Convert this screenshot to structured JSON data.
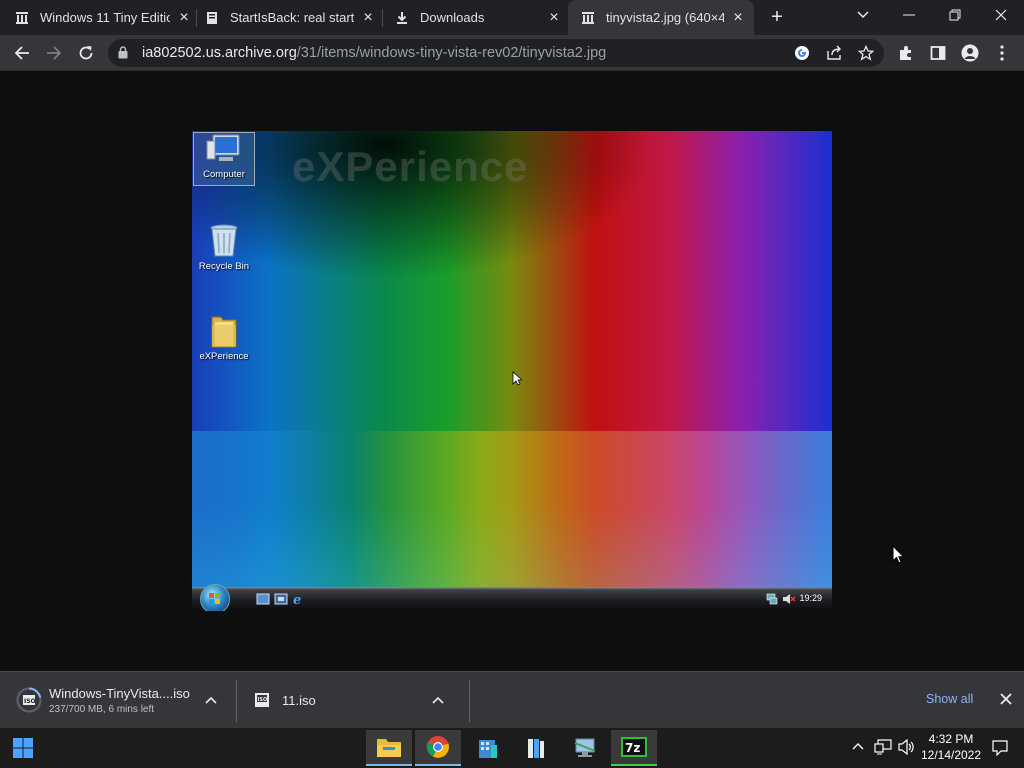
{
  "browser": {
    "tabs": [
      {
        "title": "Windows 11 Tiny Editio",
        "favicon": "archive-icon"
      },
      {
        "title": "StartIsBack: real start m",
        "favicon": "doc-icon"
      },
      {
        "title": "Downloads",
        "favicon": "download-icon"
      },
      {
        "title": "tinyvista2.jpg (640×48",
        "favicon": "archive-icon",
        "active": true
      }
    ],
    "address": {
      "host": "ia802502.us.archive.org",
      "path": "/31/items/windows-tiny-vista-rev02/tinyvista2.jpg"
    }
  },
  "screenshot": {
    "watermark": "eXPerience",
    "icons": [
      "Computer",
      "Recycle Bin",
      "eXPerience"
    ],
    "clock": "19:29"
  },
  "downloads": {
    "items": [
      {
        "name": "Windows-TinyVista....iso",
        "status": "237/700 MB, 6 mins left"
      },
      {
        "name": "11.iso",
        "status": ""
      }
    ],
    "show_all": "Show all"
  },
  "taskbar": {
    "apps": [
      "file-explorer",
      "chrome",
      "building-app",
      "archive-app",
      "computer-app",
      "7zip"
    ],
    "time": "4:32 PM",
    "date": "12/14/2022"
  },
  "colors": {
    "tabstrip": "#202124",
    "toolbar": "#35363a",
    "link": "#8ab4f8",
    "taskbar": "#1c1c1c"
  }
}
